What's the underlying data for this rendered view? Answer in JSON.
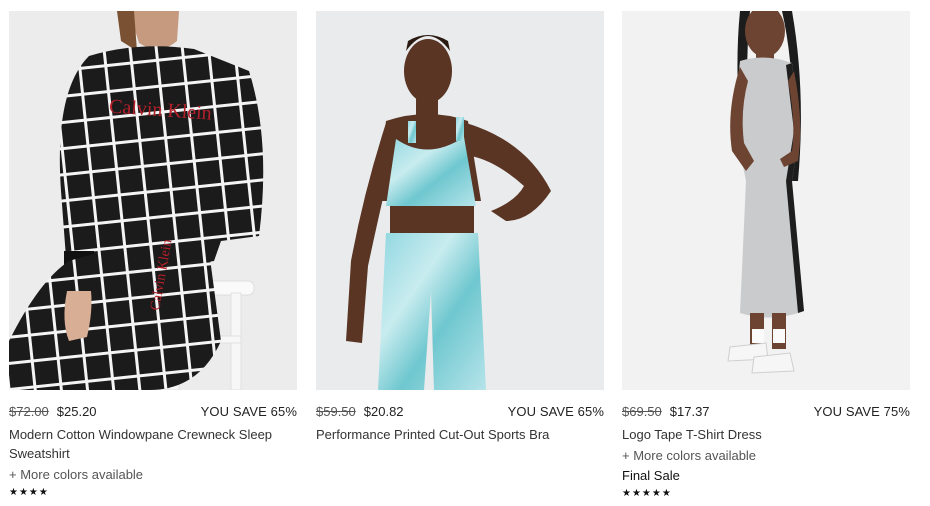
{
  "products": [
    {
      "was_price": "$72.00",
      "sale_price": "$25.20",
      "savings": "YOU SAVE 65%",
      "name": "Modern Cotton Windowpane Crewneck Sleep Sweatshirt",
      "colors_note": "+ More colors available",
      "badge": "",
      "stars": "★★★★",
      "image_text": "Calvin Klein"
    },
    {
      "was_price": "$59.50",
      "sale_price": "$20.82",
      "savings": "YOU SAVE 65%",
      "name": "Performance Printed Cut-Out Sports Bra",
      "colors_note": "",
      "badge": "",
      "stars": ""
    },
    {
      "was_price": "$69.50",
      "sale_price": "$17.37",
      "savings": "YOU SAVE 75%",
      "name": "Logo Tape T-Shirt Dress",
      "colors_note": "+ More colors available",
      "badge": "Final Sale",
      "stars": "★★★★★"
    }
  ],
  "colors": {
    "text": "#333333",
    "sweatshirt": "#1b1b1b",
    "logo_red": "#b3202a",
    "dress": "#c9cbcd",
    "tie_dye": "#8fd6e0"
  }
}
